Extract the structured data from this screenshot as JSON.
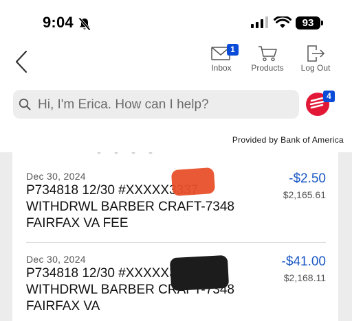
{
  "status_bar": {
    "time": "9:04",
    "battery": "93"
  },
  "nav": {
    "inbox_label": "Inbox",
    "inbox_badge": "1",
    "products_label": "Products",
    "logout_label": "Log Out"
  },
  "search": {
    "placeholder": "Hi, I'm Erica. How can I help?",
    "erica_badge": "4"
  },
  "provided_by": "Provided by Bank of America",
  "colors": {
    "accent_blue": "#1a58c4",
    "badge_blue": "#0a4bd8",
    "erica_red": "#e31837"
  },
  "transactions": [
    {
      "date": "Dec 30, 2024",
      "desc": "P734818 12/30 #XXXXX3337 WITHDRWL BARBER CRAFT-7348 FAIRFAX VA FEE",
      "amount": "-$2.50",
      "balance": "$2,165.61"
    },
    {
      "date": "Dec 30, 2024",
      "desc": "P734818 12/30 #XXXXX3337 WITHDRWL BARBER CRAFT-7348 FAIRFAX VA",
      "amount": "-$41.00",
      "balance": "$2,168.11"
    }
  ]
}
